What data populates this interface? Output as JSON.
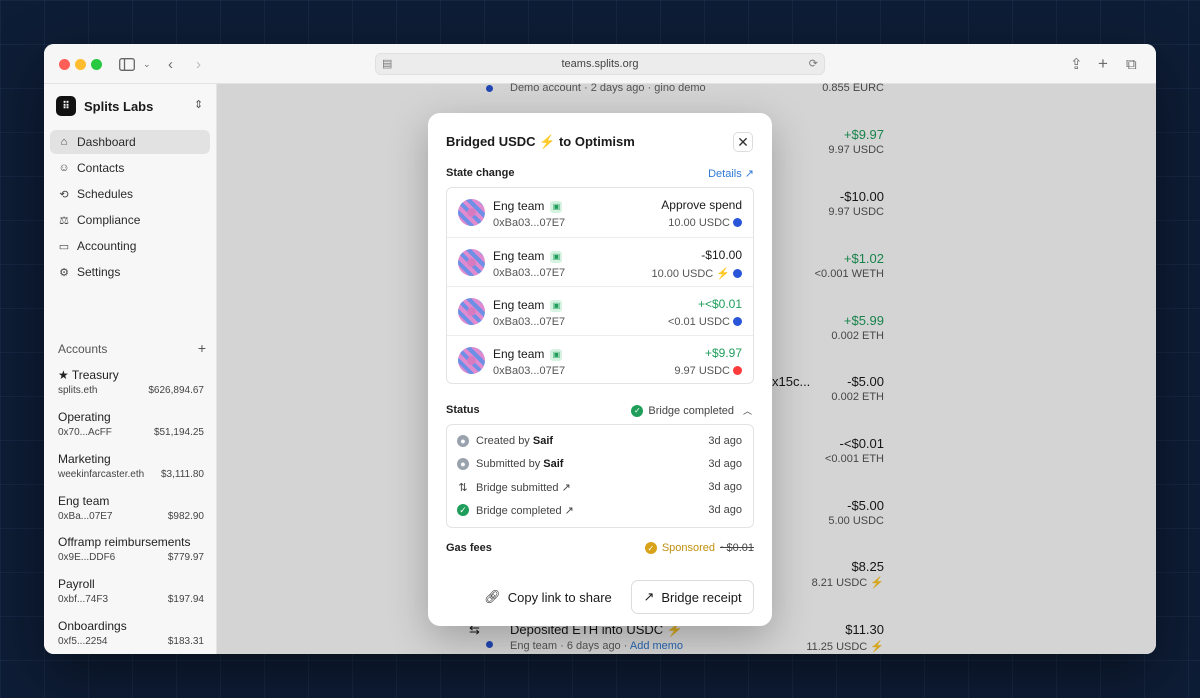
{
  "browser": {
    "url": "teams.splits.org"
  },
  "org": {
    "name": "Splits Labs"
  },
  "nav": [
    {
      "label": "Dashboard",
      "icon": "home-icon"
    },
    {
      "label": "Contacts",
      "icon": "contacts-icon"
    },
    {
      "label": "Schedules",
      "icon": "schedules-icon"
    },
    {
      "label": "Compliance",
      "icon": "scale-icon"
    },
    {
      "label": "Accounting",
      "icon": "book-icon"
    },
    {
      "label": "Settings",
      "icon": "gear-icon"
    }
  ],
  "accounts_header": "Accounts",
  "accounts": [
    {
      "name": "★ Treasury",
      "address": "splits.eth",
      "balance": "$626,894.67"
    },
    {
      "name": "Operating",
      "address": "0x70...AcFF",
      "balance": "$51,194.25"
    },
    {
      "name": "Marketing",
      "address": "weekinfarcaster.eth",
      "balance": "$3,111.80"
    },
    {
      "name": "Eng team",
      "address": "0xBa...07E7",
      "balance": "$982.90"
    },
    {
      "name": "Offramp reimbursements",
      "address": "0x9E...DDF6",
      "balance": "$779.97"
    },
    {
      "name": "Payroll",
      "address": "0xbf...74F3",
      "balance": "$197.94"
    },
    {
      "name": "Onboardings",
      "address": "0xf5...2254",
      "balance": "$183.31"
    }
  ],
  "background": {
    "top_row": {
      "subtitle": "Demo account · 2 days ago · gino demo",
      "amount_sub": "0.855 EURC"
    },
    "amounts": [
      {
        "amount": "+$9.97",
        "sub": "9.97 USDC",
        "positive": true
      },
      {
        "amount": "-$10.00",
        "sub": "9.97 USDC",
        "positive": false
      },
      {
        "amount": "+$1.02",
        "sub": "<0.001 WETH",
        "positive": true
      },
      {
        "amount": "+$5.99",
        "sub": "0.002 ETH",
        "positive": true
      },
      {
        "amount": "-$5.00",
        "sub": "0.002 ETH",
        "positive": false
      },
      {
        "amount": "-<$0.01",
        "sub": "<0.001 ETH",
        "positive": false
      },
      {
        "amount": "-$5.00",
        "sub": "5.00 USDC",
        "positive": false
      },
      {
        "amount": "$8.25",
        "sub": "8.21 USDC ⚡",
        "positive": false
      }
    ],
    "partial_text": "x15c...",
    "bottom_row": {
      "title": "Deposited ETH into USDC ⚡",
      "subtitle_prefix": "Eng team · 6 days ago · ",
      "subtitle_link": "Add memo",
      "amount": "$11.30",
      "amount_sub": "11.25 USDC ⚡"
    }
  },
  "modal": {
    "title": "Bridged USDC ⚡ to Optimism",
    "state_change_label": "State change",
    "details_link": "Details",
    "rows": [
      {
        "name": "Eng team",
        "address": "0xBa03...07E7",
        "amount": "Approve spend",
        "sub": "10.00 USDC",
        "color": "#1a1a1a",
        "token": "usdc"
      },
      {
        "name": "Eng team",
        "address": "0xBa03...07E7",
        "amount": "-$10.00",
        "sub": "10.00 USDC ⚡",
        "color": "#1a1a1a",
        "token": "usdc"
      },
      {
        "name": "Eng team",
        "address": "0xBa03...07E7",
        "amount": "+<$0.01",
        "sub": "<0.01 USDC",
        "color": "#1e9e5a",
        "token": "usdc"
      },
      {
        "name": "Eng team",
        "address": "0xBa03...07E7",
        "amount": "+$9.97",
        "sub": "9.97 USDC",
        "color": "#1e9e5a",
        "token": "op"
      }
    ],
    "status_label": "Status",
    "status_value": "Bridge completed",
    "timeline": [
      {
        "prefix": "Created by ",
        "who": "Saif",
        "time": "3d ago",
        "icon": "person"
      },
      {
        "prefix": "Submitted by ",
        "who": "Saif",
        "time": "3d ago",
        "icon": "person"
      },
      {
        "prefix": "Bridge submitted",
        "who": "",
        "time": "3d ago",
        "icon": "arr"
      },
      {
        "prefix": "Bridge completed",
        "who": "",
        "time": "3d ago",
        "icon": "ok"
      }
    ],
    "gas_label": "Gas fees",
    "gas_sponsored": "Sponsored",
    "gas_amount": "~$0.01",
    "copy_button": "Copy link to share",
    "receipt_button": "Bridge receipt"
  }
}
